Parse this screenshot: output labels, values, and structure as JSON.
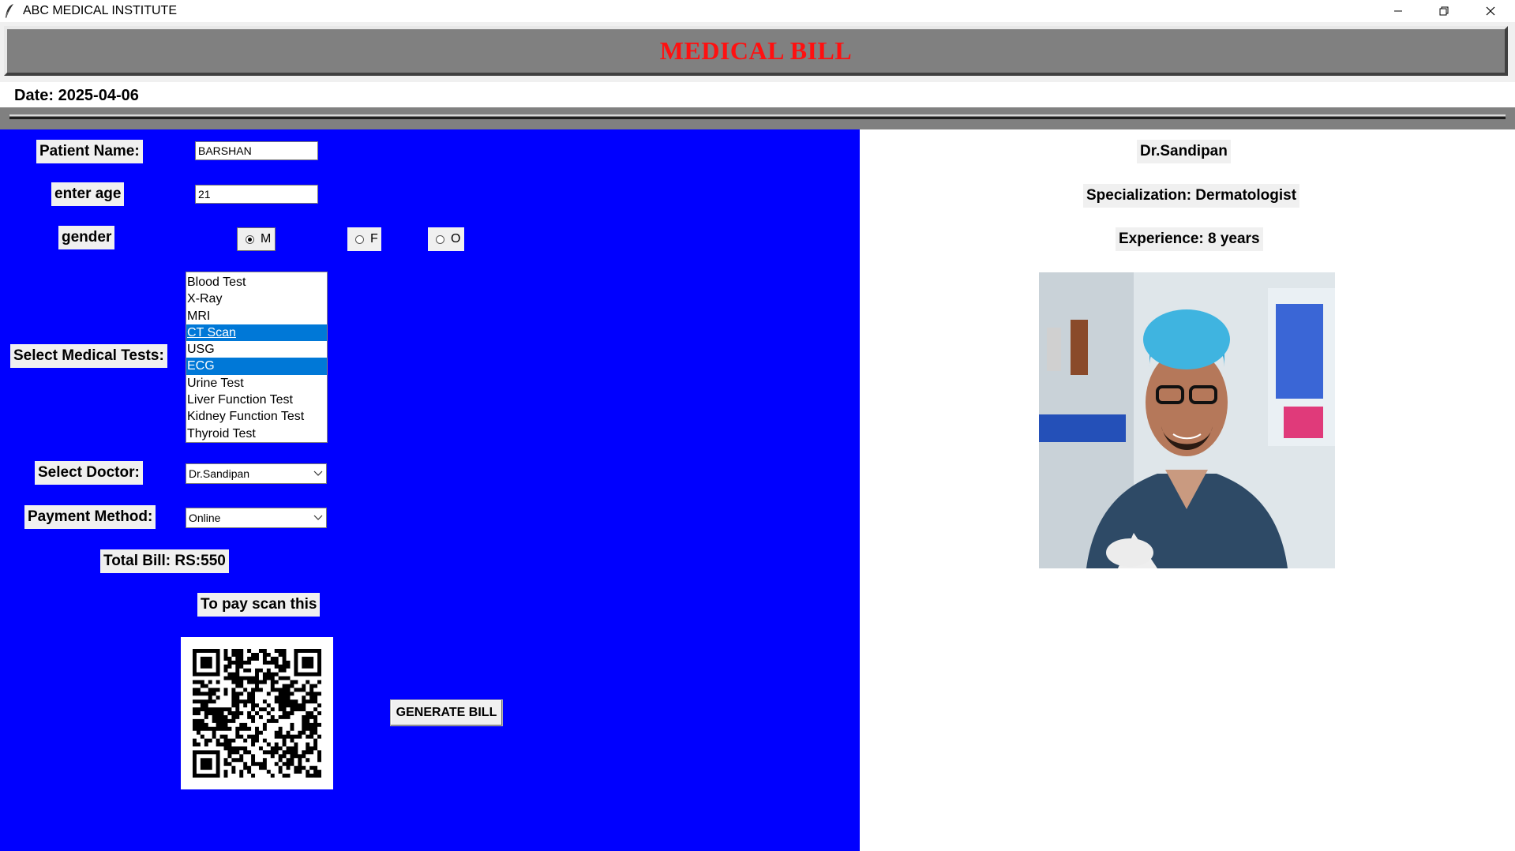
{
  "window": {
    "title": "ABC MEDICAL INSTITUTE",
    "icons": [
      "feather-icon",
      "minimize-icon",
      "restore-icon",
      "close-icon"
    ]
  },
  "header": {
    "title": "MEDICAL BILL",
    "title_color": "#ff1010"
  },
  "date_label": "Date: 2025-04-06",
  "form": {
    "patient_name_label": "Patient Name:",
    "patient_name_value": "BARSHAN",
    "age_label": "enter age",
    "age_value": "21",
    "gender_label": "gender",
    "gender_options": [
      "M",
      "F",
      "O"
    ],
    "gender_selected": "M",
    "tests_label": "Select Medical Tests:",
    "tests": [
      "Blood Test",
      "X-Ray",
      "MRI",
      "CT Scan",
      "USG",
      "ECG",
      "Urine Test",
      "Liver Function Test",
      "Kidney Function Test",
      "Thyroid Test"
    ],
    "tests_selected": [
      "CT Scan",
      "ECG"
    ],
    "doctor_label": "Select Doctor:",
    "doctor_value": "Dr.Sandipan",
    "payment_label": "Payment Method:",
    "payment_value": "Online",
    "total_bill": "Total Bill: RS:550",
    "pay_hint": "To pay scan this",
    "generate_button": "GENERATE BILL"
  },
  "doctor": {
    "name": "Dr.Sandipan",
    "specialization": "Specialization: Dermatologist",
    "experience": "Experience: 8 years"
  },
  "colors": {
    "panel_blue": "#0000ff",
    "header_gray": "#808080",
    "selection": "#0078d7"
  }
}
